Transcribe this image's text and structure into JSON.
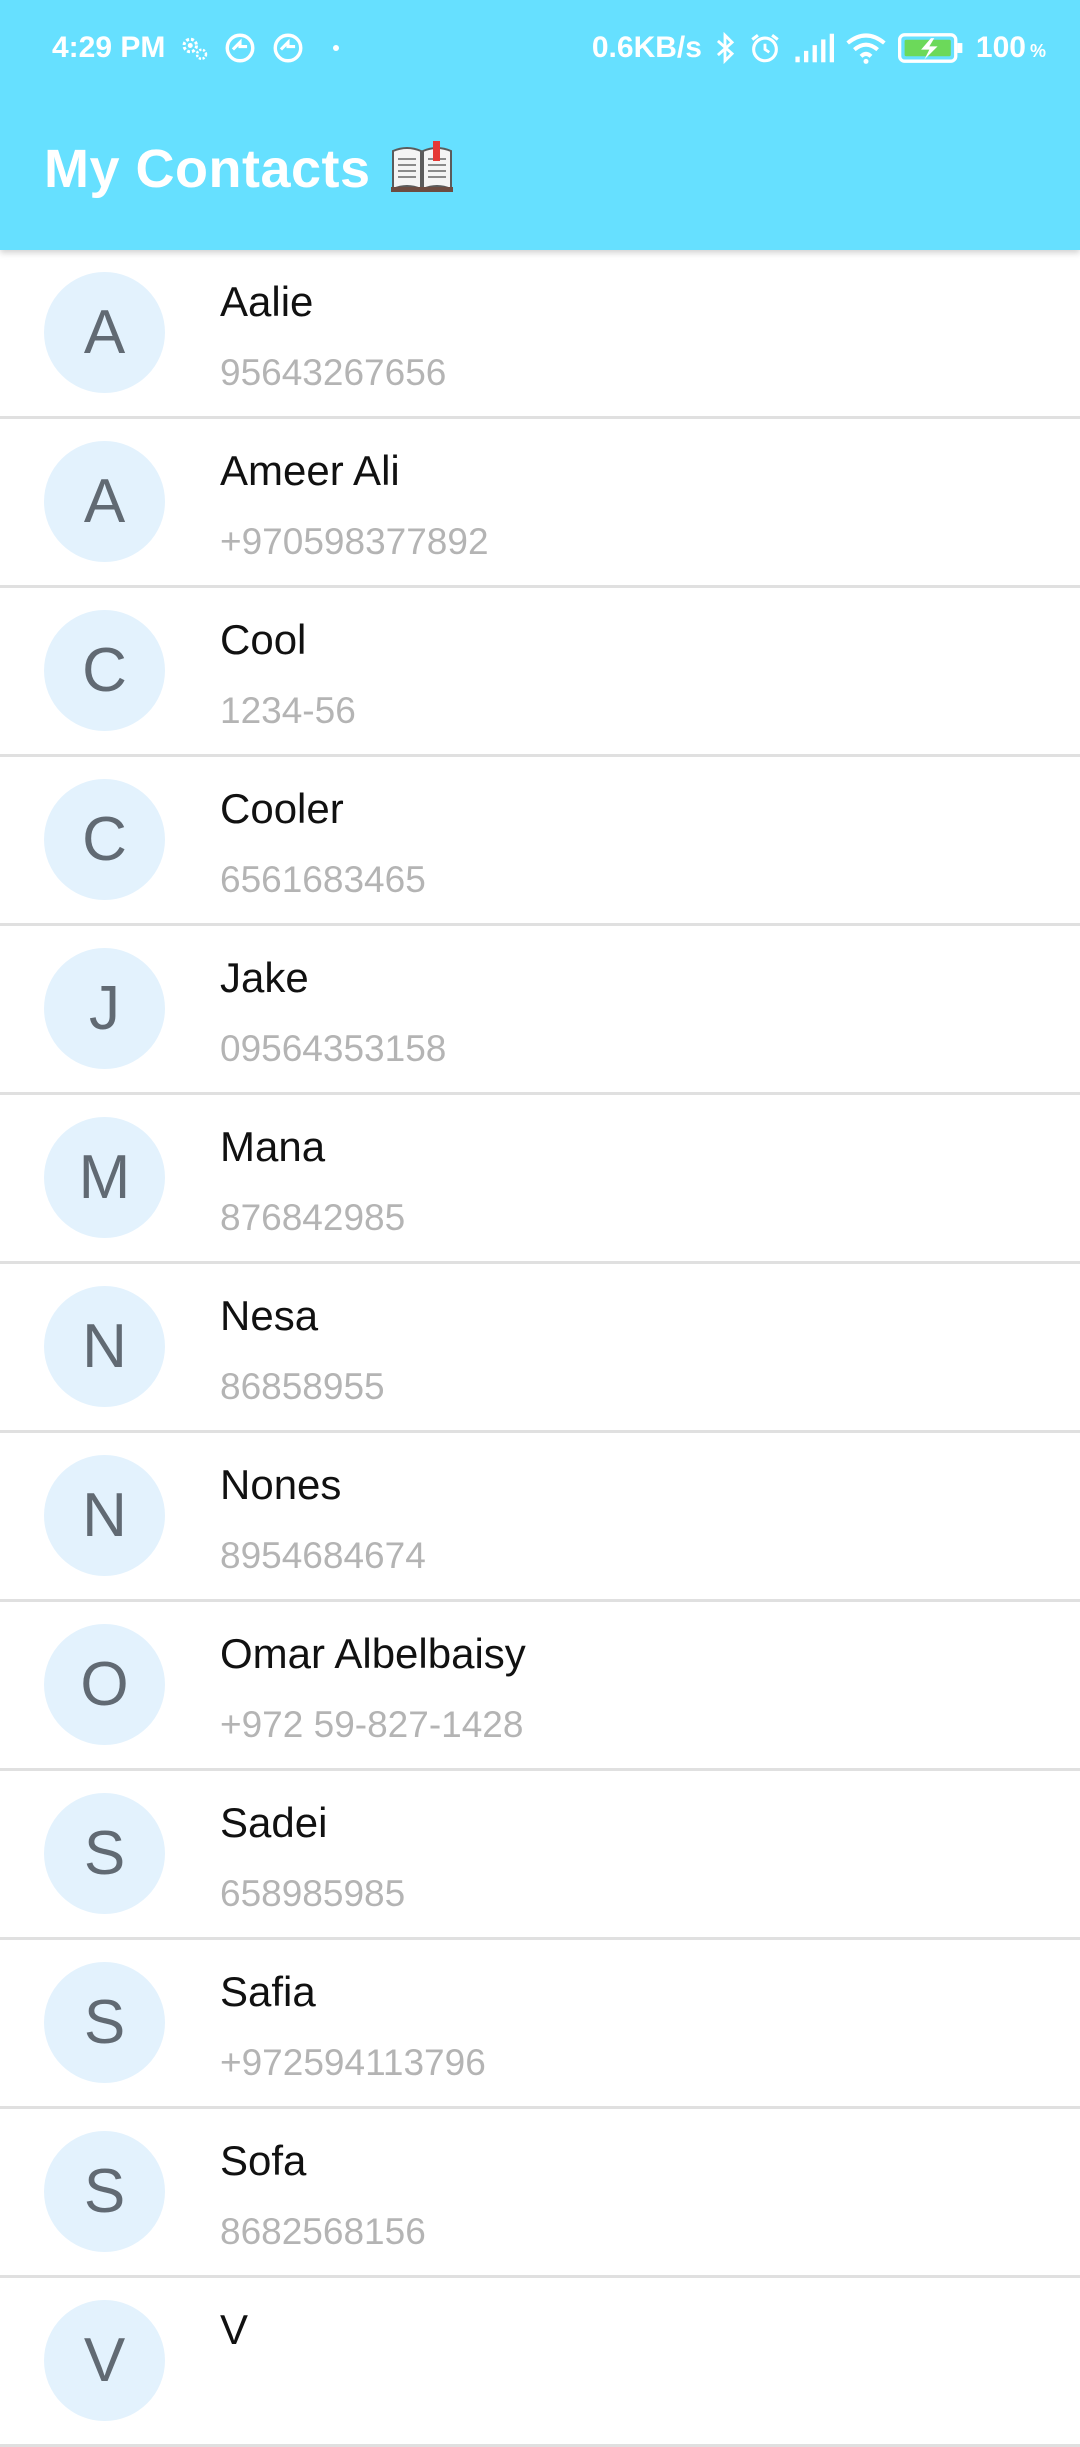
{
  "status_bar": {
    "time": "4:29 PM",
    "net_speed": "0.6KB/s",
    "battery_percent": "100",
    "battery_unit": "%",
    "icons": [
      "settings-gear-icon",
      "sync-icon",
      "sync-icon",
      "dot-icon",
      "bluetooth-icon",
      "alarm-icon",
      "signal-icon",
      "wifi-icon",
      "battery-charging-icon"
    ]
  },
  "app_bar": {
    "title": "My Contacts",
    "title_icon": "open-book-icon",
    "background": "#66e0ff"
  },
  "contacts": [
    {
      "initial": "A",
      "name": "Aalie",
      "phone": "95643267656"
    },
    {
      "initial": "A",
      "name": "Ameer Ali",
      "phone": "+970598377892"
    },
    {
      "initial": "C",
      "name": "Cool",
      "phone": "1234-56"
    },
    {
      "initial": "C",
      "name": "Cooler",
      "phone": "6561683465"
    },
    {
      "initial": "J",
      "name": "Jake",
      "phone": "09564353158"
    },
    {
      "initial": "M",
      "name": "Mana",
      "phone": "876842985"
    },
    {
      "initial": "N",
      "name": "Nesa",
      "phone": "86858955"
    },
    {
      "initial": "N",
      "name": "Nones",
      "phone": "8954684674"
    },
    {
      "initial": "O",
      "name": "Omar Albelbaisy",
      "phone": "+972 59-827-1428"
    },
    {
      "initial": "S",
      "name": "Sadei",
      "phone": "658985985"
    },
    {
      "initial": "S",
      "name": "Safia",
      "phone": "+972594113796"
    },
    {
      "initial": "S",
      "name": "Sofa",
      "phone": "8682568156"
    },
    {
      "initial": "V",
      "name": "V",
      "phone": ""
    }
  ],
  "colors": {
    "avatar_bg": "#e3f2fd",
    "avatar_text": "#616a73",
    "name_text": "#111111",
    "phone_text": "#b4b4b4",
    "divider": "#e0e0e0"
  }
}
